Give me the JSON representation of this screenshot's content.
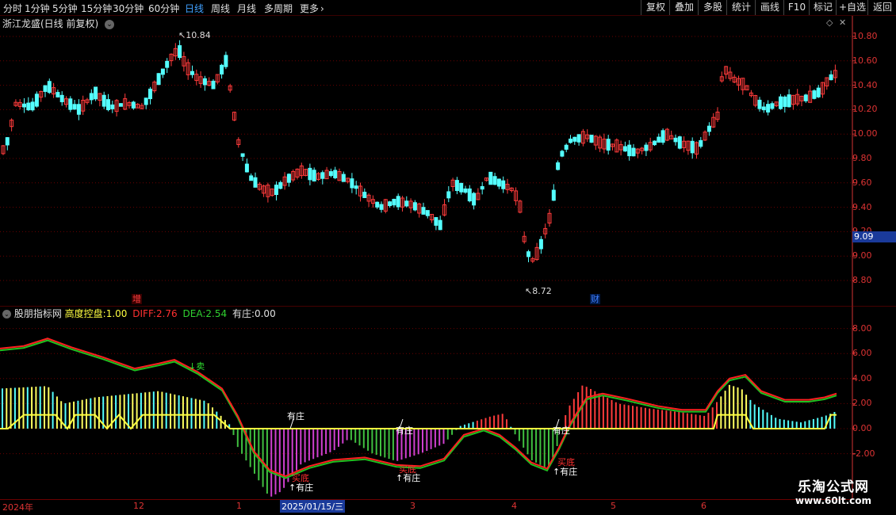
{
  "toolbar": {
    "periods": [
      {
        "label": "分时",
        "active": false
      },
      {
        "label": "1分钟",
        "active": false
      },
      {
        "label": "5分钟",
        "active": false
      },
      {
        "label": "15分钟",
        "active": false
      },
      {
        "label": "30分钟",
        "active": false
      },
      {
        "label": "60分钟",
        "active": false
      },
      {
        "label": "日线",
        "active": true
      },
      {
        "label": "周线",
        "active": false
      },
      {
        "label": "月线",
        "active": false
      },
      {
        "label": "多周期",
        "active": false
      },
      {
        "label": "更多",
        "active": false
      }
    ],
    "more_arrow": "›",
    "right_buttons": [
      "复权",
      "叠加",
      "多股",
      "统计",
      "画线",
      "F10",
      "标记",
      "+自选",
      "返回"
    ]
  },
  "main_panel": {
    "title": "浙江龙盛(日线 前复权)",
    "high_label": "10.84",
    "low_label": "8.72",
    "current_price": "9.09",
    "y_ticks": [
      "10.80",
      "10.60",
      "10.40",
      "10.20",
      "10.00",
      "9.80",
      "9.60",
      "9.40",
      "9.20",
      "9.00",
      "8.80"
    ],
    "marker_zeng": "增",
    "marker_cai": "财"
  },
  "indicator_panel": {
    "name": "股朋指标网",
    "gaodu_label": "高度控盘:",
    "gaodu_value": "1.00",
    "diff_label": "DIFF:",
    "diff_value": "2.76",
    "dea_label": "DEA:",
    "dea_value": "2.54",
    "youzhuang_label": "有庄:",
    "youzhuang_value": "0.00",
    "y_ticks": [
      "8.00",
      "6.00",
      "4.00",
      "2.00",
      "0.00",
      "-2.00"
    ],
    "signals": {
      "sell": "卖",
      "buy_bottom": "买底",
      "you_zhuang": "有庄",
      "up_you_zhuang": "↑有庄"
    }
  },
  "date_axis": {
    "labels": [
      "2024年",
      "12",
      "1",
      "2025/01/15/三",
      "3",
      "4",
      "5",
      "6"
    ]
  },
  "watermark": {
    "line1": "乐淘公式网",
    "line2": "www.60lt.com"
  },
  "colors": {
    "up": "#ff3b3b",
    "down": "#54ffff",
    "grid": "#6a0000",
    "axis_text": "#d33333",
    "active_period": "#40a0ff",
    "diff_line": "#ff2020",
    "dea_line": "#20c020",
    "magenta_bar": "#d040d0",
    "green_bar": "#40c040",
    "yellow_line": "#ffff40"
  }
}
